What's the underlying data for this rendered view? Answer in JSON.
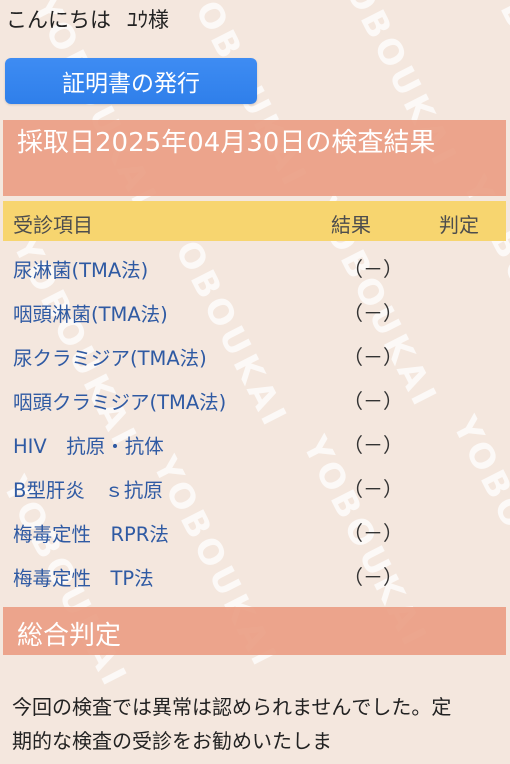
{
  "greeting": {
    "hello": "こんにちは",
    "user_name": "ﾕｳ様"
  },
  "certificate_button": {
    "label": "証明書の発行"
  },
  "result_header": {
    "title": "採取日2025年04月30日の検査結果"
  },
  "table": {
    "headers": {
      "item": "受診項目",
      "result": "結果",
      "judgement": "判定"
    },
    "rows": [
      {
        "item": "尿淋菌(TMA法)",
        "result": "（－）",
        "judgement": ""
      },
      {
        "item": "咽頭淋菌(TMA法)",
        "result": "（－）",
        "judgement": ""
      },
      {
        "item": "尿クラミジア(TMA法)",
        "result": "（－）",
        "judgement": ""
      },
      {
        "item": "咽頭クラミジア(TMA法)",
        "result": "（－）",
        "judgement": ""
      },
      {
        "item": "HIV　抗原・抗体",
        "result": "（－）",
        "judgement": ""
      },
      {
        "item": "B型肝炎　ｓ抗原",
        "result": "（－）",
        "judgement": ""
      },
      {
        "item": "梅毒定性　RPR法",
        "result": "（－）",
        "judgement": ""
      },
      {
        "item": "梅毒定性　TP法",
        "result": "（－）",
        "judgement": ""
      }
    ]
  },
  "overall": {
    "title": "総合判定",
    "text": "今回の検査では異常は認められませんでした。定期的な検査の受診をお勧めいたしま"
  },
  "watermark": {
    "text": "YOBOUKAI"
  },
  "colors": {
    "background": "#f4e7de",
    "button": "#2f7fea",
    "section_header": "#ea9e84",
    "table_header": "#f7d56f",
    "item_text": "#2f5aa3"
  }
}
